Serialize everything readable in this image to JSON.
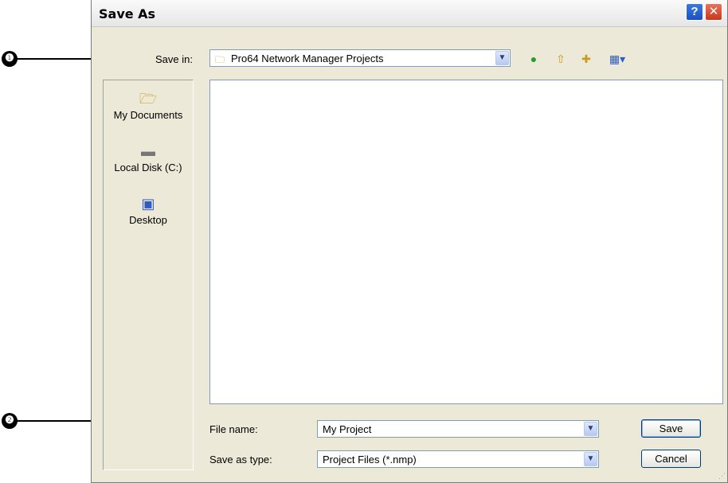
{
  "callouts": [
    "❶",
    "❷"
  ],
  "window": {
    "title": "Save As",
    "help_label": "?",
    "close_label": "✕"
  },
  "toolbar": {
    "save_in_label": "Save in:",
    "save_in_value": "Pro64 Network Manager Projects",
    "icons": [
      "back-icon",
      "up-folder-icon",
      "new-folder-icon",
      "views-menu-icon"
    ]
  },
  "places": [
    {
      "label": "My Documents",
      "icon": "my-documents-icon"
    },
    {
      "label": "Local Disk (C:)",
      "icon": "local-disk-icon"
    },
    {
      "label": "Desktop",
      "icon": "desktop-icon"
    }
  ],
  "form": {
    "file_name_label": "File name:",
    "file_name_value": "My Project",
    "save_as_type_label": "Save as type:",
    "save_as_type_value": "Project Files (*.nmp)"
  },
  "buttons": {
    "save": "Save",
    "cancel": "Cancel"
  }
}
